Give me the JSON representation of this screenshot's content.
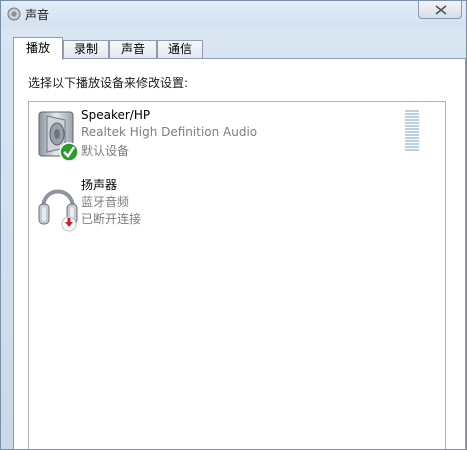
{
  "window": {
    "title": "声音"
  },
  "tabs": [
    {
      "label": "播放",
      "active": true
    },
    {
      "label": "录制",
      "active": false
    },
    {
      "label": "声音",
      "active": false
    },
    {
      "label": "通信",
      "active": false
    }
  ],
  "panel": {
    "instruction": "选择以下播放设备来修改设置:",
    "devices": [
      {
        "name": "Speaker/HP",
        "driver": "Realtek High Definition Audio",
        "status": "默认设备",
        "icon": "speaker-icon",
        "badge": "default-check-icon"
      },
      {
        "name": "扬声器",
        "driver": "蓝牙音频",
        "status": "已断开连接",
        "icon": "headphones-icon",
        "badge": "disconnected-arrow-icon"
      }
    ]
  },
  "colors": {
    "check_green": "#2e9a2e",
    "disconnect_red": "#c8232a",
    "meter": "#b9cfe2"
  }
}
